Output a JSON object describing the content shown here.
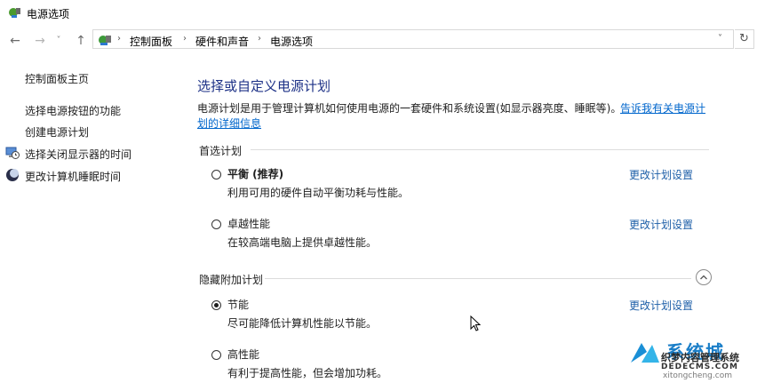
{
  "window": {
    "title": "电源选项"
  },
  "nav": {
    "back": "←",
    "forward": "→",
    "dropdown": "˅",
    "up": "↑",
    "refresh": "↻",
    "breadcrumbs": [
      "控制面板",
      "硬件和声音",
      "电源选项"
    ],
    "separator": "›"
  },
  "sidebar": {
    "home": "控制面板主页",
    "items": [
      {
        "label": "选择电源按钮的功能",
        "icon": "none"
      },
      {
        "label": "创建电源计划",
        "icon": "none"
      },
      {
        "label": "选择关闭显示器的时间",
        "icon": "monitor-clock-icon"
      },
      {
        "label": "更改计算机睡眠时间",
        "icon": "moon-icon"
      }
    ]
  },
  "main": {
    "heading": "选择或自定义电源计划",
    "desc": "电源计划是用于管理计算机如何使用电源的一套硬件和系统设置(如显示器亮度、睡眠等)。",
    "desc_link_part1": "告诉我有关电源计",
    "desc_link_part2": "划的详细信息",
    "preferred_label": "首选计划",
    "hidden_label": "隐藏附加计划",
    "plans": [
      {
        "name": "平衡 (推荐)",
        "desc": "利用可用的硬件自动平衡功耗与性能。",
        "link": "更改计划设置",
        "selected": false
      },
      {
        "name": "卓越性能",
        "desc": "在较高端电脑上提供卓越性能。",
        "link": "更改计划设置",
        "selected": false
      },
      {
        "name": "节能",
        "desc": "尽可能降低计算机性能以节能。",
        "link": "更改计划设置",
        "selected": true
      },
      {
        "name": "高性能",
        "desc": "有利于提高性能，但会增加功耗。",
        "link": "",
        "selected": false
      }
    ]
  },
  "watermark": {
    "line1": "系统城",
    "line2": "织梦内容管理系统",
    "line3": "DEDECMS.COM",
    "line4": "xitongcheng.com"
  }
}
